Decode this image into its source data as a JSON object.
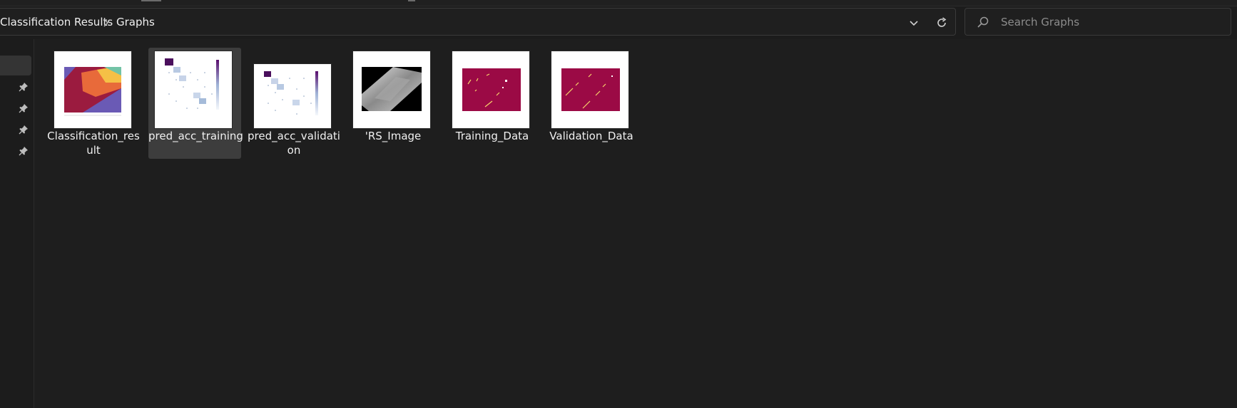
{
  "breadcrumb": {
    "parent": "Classification Results",
    "separator": "›",
    "current": "Graphs"
  },
  "search": {
    "placeholder": "Search Graphs"
  },
  "icons": {
    "chevron": "chevron-down-icon",
    "refresh": "refresh-icon",
    "search": "search-icon",
    "pin": "pin-icon"
  },
  "files": [
    {
      "name_line1": "Classification_res",
      "name_line2": "ult",
      "thumbnail": "classification-map"
    },
    {
      "name_line1": "pred_acc_training",
      "name_line2": "",
      "thumbnail": "confusion-matrix",
      "selected": true
    },
    {
      "name_line1": "pred_acc_validati",
      "name_line2": "on",
      "thumbnail": "confusion-matrix"
    },
    {
      "name_line1": "'RS_Image",
      "name_line2": "",
      "thumbnail": "grayscale-image"
    },
    {
      "name_line1": "Training_Data",
      "name_line2": "",
      "thumbnail": "sample-map"
    },
    {
      "name_line1": "Validation_Data",
      "name_line2": "",
      "thumbnail": "sample-map"
    }
  ],
  "colors": {
    "background": "#1c1c1c",
    "text": "#f0f0f0",
    "placeholder": "#8c8c8c",
    "selection": "#3d3d3d",
    "crimson": "#9b0a45",
    "purple": "#5a0e6e"
  }
}
